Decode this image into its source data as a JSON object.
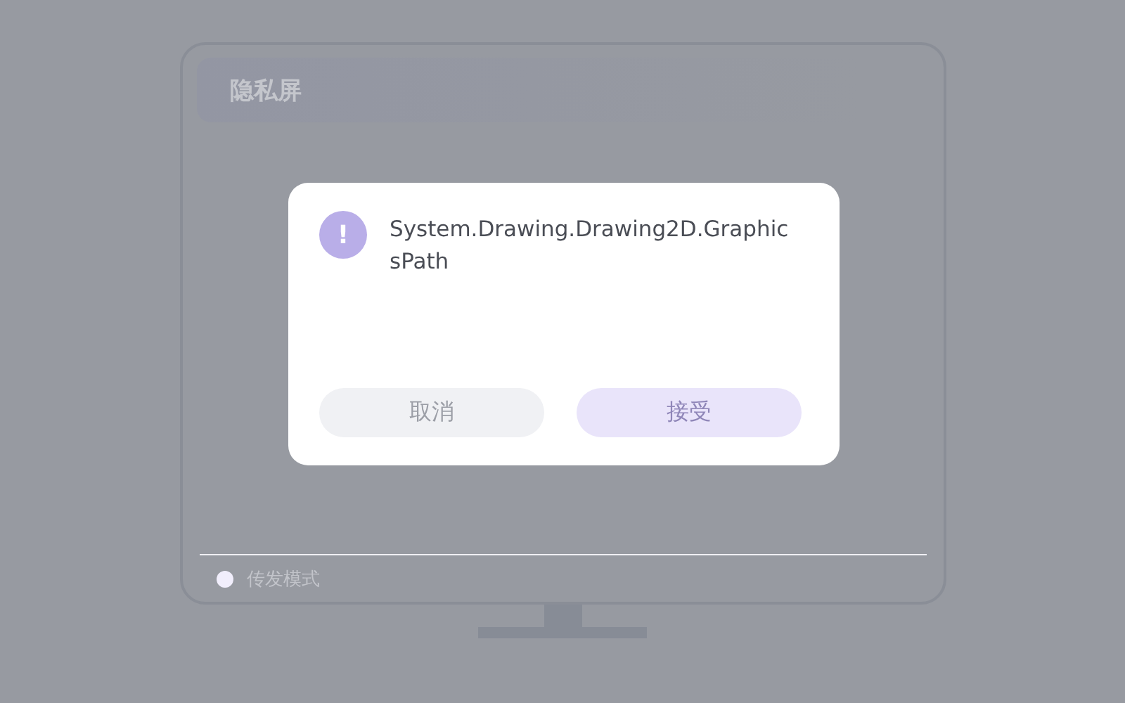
{
  "screen": {
    "title": "隐私屏",
    "mode": {
      "label": "传发模式",
      "on": true
    }
  },
  "dialog": {
    "icon": "!",
    "message": "System.Drawing.Drawing2D.GraphicsPath",
    "buttons": [
      {
        "label": "取消",
        "kind": "cancel"
      },
      {
        "label": "接受",
        "kind": "accept"
      }
    ]
  }
}
